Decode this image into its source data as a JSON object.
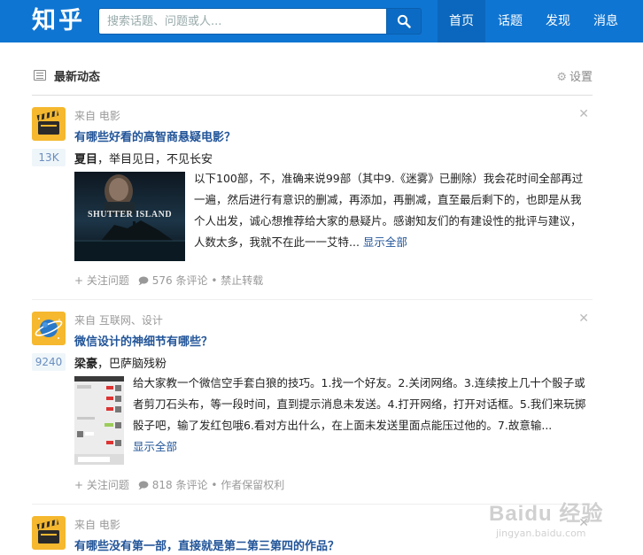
{
  "header": {
    "logo": "知乎",
    "search_placeholder": "搜索话题、问题或人...",
    "nav": [
      "首页",
      "话题",
      "发现",
      "消息"
    ],
    "active_nav": "首页",
    "brand_color": "#0f75d2"
  },
  "section": {
    "title": "最新动态",
    "settings_label": "设置"
  },
  "feed": [
    {
      "from": "来自 电影",
      "title": "有哪些好看的高智商悬疑电影？",
      "votes": "13K",
      "author_name": "夏目",
      "author_bio": "，举目见日，不见长安",
      "thumb_text": "SHUTTER ISLAND",
      "summary": "以下100部，不，准确来说99部（其中9.《迷雾》已删除）我会花时间全部再过一遍，然后进行有意识的删减，再添加，再删减，直至最后剩下的，也即是从我个人出发，诚心想推荐给大家的悬疑片。感谢知友们的有建设性的批评与建议，人数太多，我就不在此一一艾特...",
      "show_all": "显示全部",
      "follow": "+ 关注问题",
      "comments": "576 条评论",
      "rights": "禁止转载"
    },
    {
      "from": "来自 互联网、设计",
      "title": "微信设计的神细节有哪些？",
      "votes": "9240",
      "author_name": "梁豪",
      "author_bio": "，巴萨脑残粉",
      "summary": "给大家教一个微信空手套白狼的技巧。1.找一个好友。2.关闭网络。3.连续按上几十个骰子或者剪刀石头布，等一段时间，直到提示消息未发送。4.打开网络，打开对话框。5.我们来玩掷骰子吧，输了发红包哦6.看对方出什么，在上面未发送里面点能压过他的。7.故意输...",
      "show_all": "显示全部",
      "follow": "+ 关注问题",
      "comments": "818 条评论",
      "rights": "作者保留权利"
    },
    {
      "from": "来自 电影",
      "title": "有哪些没有第一部，直接就是第二第三第四的作品？"
    }
  ],
  "watermark": {
    "logo": "Baidu 经验",
    "url": "jingyan.baidu.com"
  }
}
